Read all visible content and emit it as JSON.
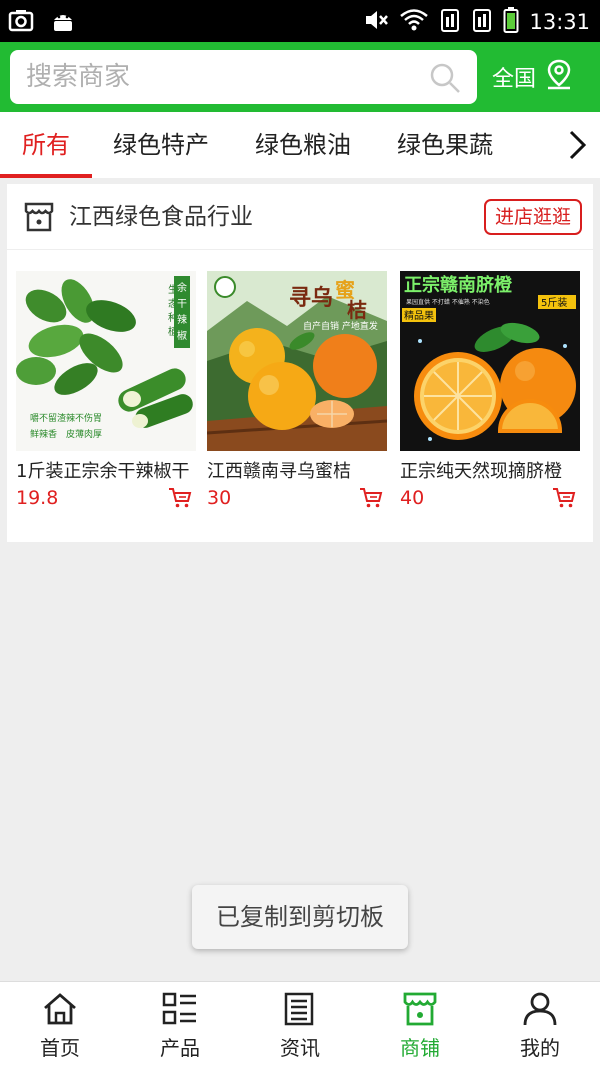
{
  "status_bar": {
    "time": "13:31"
  },
  "search": {
    "placeholder": "搜索商家",
    "region_label": "全国"
  },
  "tabs": [
    {
      "label": "所有",
      "active": true
    },
    {
      "label": "绿色特产",
      "active": false
    },
    {
      "label": "绿色粮油",
      "active": false
    },
    {
      "label": "绿色果蔬",
      "active": false
    }
  ],
  "shop": {
    "name": "江西绿色食品行业",
    "visit_label": "进店逛逛",
    "products": [
      {
        "title": "1斤装正宗余干辣椒干",
        "price": "19.8",
        "image_text": [
          "生态种植",
          "施农家肥",
          "余干辣椒",
          "嚼不留渣",
          "辣不伤胃",
          "鲜辣香",
          "皮薄肉厚"
        ]
      },
      {
        "title": "江西赣南寻乌蜜桔",
        "price": "30",
        "image_text": [
          "寻乌蜜桔",
          "自产自销",
          "产地直发"
        ]
      },
      {
        "title": "正宗纯天然现摘脐橙",
        "price": "40",
        "image_text": [
          "正宗赣南脐橙",
          "5斤装",
          "精品果",
          "果园直供 不打蜡 不催熟 不染色"
        ]
      }
    ]
  },
  "toast": {
    "text": "已复制到剪切板"
  },
  "bottom_nav": [
    {
      "label": "首页",
      "icon": "home-icon",
      "active": false
    },
    {
      "label": "产品",
      "icon": "product-list-icon",
      "active": false
    },
    {
      "label": "资讯",
      "icon": "news-icon",
      "active": false
    },
    {
      "label": "商铺",
      "icon": "store-icon",
      "active": true
    },
    {
      "label": "我的",
      "icon": "user-icon",
      "active": false
    }
  ],
  "colors": {
    "brand_green": "#22bb33",
    "accent_red": "#e02020",
    "nav_active": "#22aa33"
  }
}
